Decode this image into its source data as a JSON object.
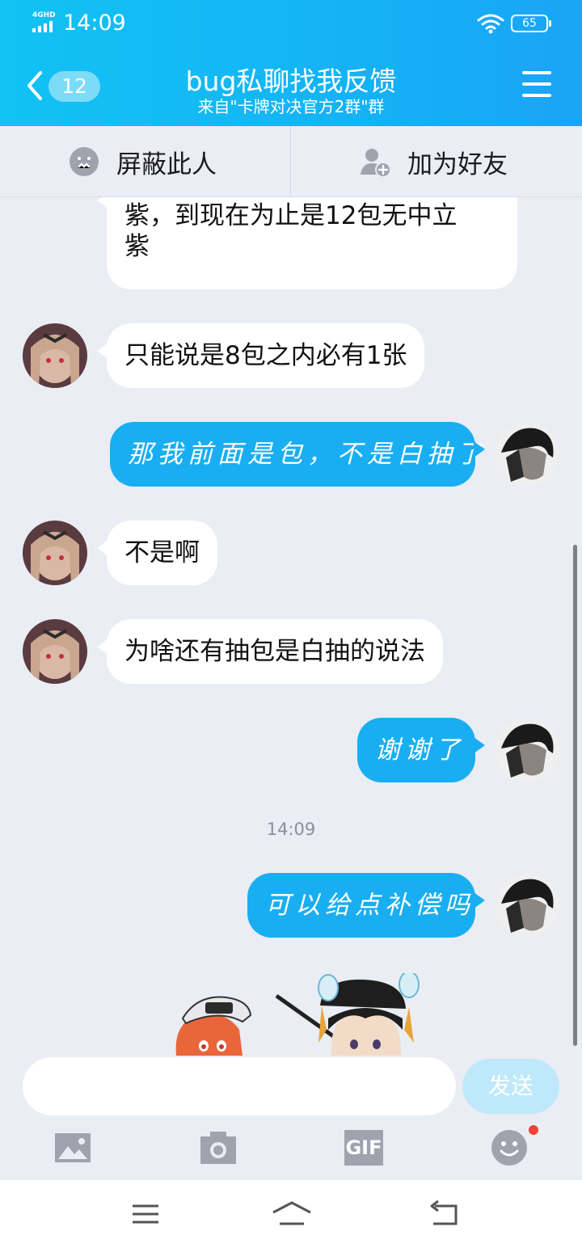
{
  "status_bar": {
    "network": "4GHD",
    "time": "14:09",
    "battery": "65"
  },
  "header": {
    "unread_count": "12",
    "title": "bug私聊找我反馈",
    "subtitle": "来自\"卡牌对决官方2群\"群"
  },
  "actions": {
    "block_label": "屏蔽此人",
    "add_friend_label": "加为好友"
  },
  "messages": [
    {
      "side": "in",
      "text": "紫，到现在为止是12包无中立紫",
      "line1": "紫，到现在为止是12包无中立",
      "line2": "紫"
    },
    {
      "side": "in",
      "text": "只能说是8包之内必有1张"
    },
    {
      "side": "out",
      "text": "那我前面是包，不是白抽了"
    },
    {
      "side": "in",
      "text": "不是啊"
    },
    {
      "side": "in",
      "text": "为啥还有抽包是白抽的说法"
    },
    {
      "side": "out",
      "text": "谢谢了"
    },
    {
      "side": "time",
      "text": "14:09"
    },
    {
      "side": "out",
      "text": "可以给点补偿吗"
    }
  ],
  "input": {
    "value": "",
    "send_label": "发送"
  },
  "toolbar": {
    "icons": [
      "image-icon",
      "camera-icon",
      "gif-icon",
      "emoji-icon"
    ],
    "gif_label": "GIF"
  },
  "colors": {
    "header_gradient_start": "#12c2f3",
    "header_gradient_end": "#1aa4f6",
    "outgoing_bubble": "#19aef2",
    "incoming_bubble": "#ffffff",
    "background": "#ebedf4",
    "send_button": "#bfe9fb",
    "badge_dot": "#f0433a"
  }
}
